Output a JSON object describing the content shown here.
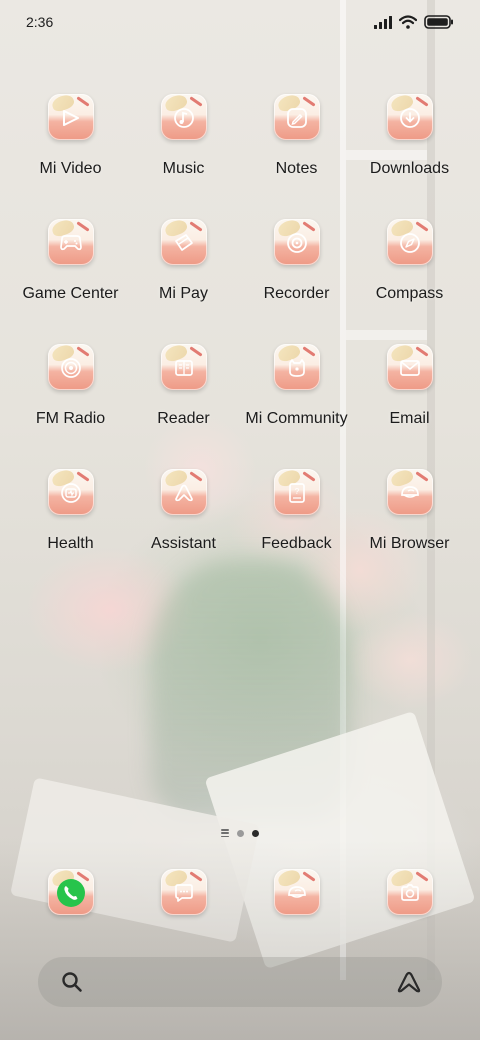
{
  "status_bar": {
    "time": "2:36",
    "icons": [
      "signal-icon",
      "wifi-icon",
      "battery-icon"
    ]
  },
  "apps": [
    {
      "label": "Mi Video",
      "icon": "play-icon"
    },
    {
      "label": "Music",
      "icon": "music-note-icon"
    },
    {
      "label": "Notes",
      "icon": "pencil-icon"
    },
    {
      "label": "Downloads",
      "icon": "download-icon"
    },
    {
      "label": "Game Center",
      "icon": "gamepad-icon"
    },
    {
      "label": "Mi Pay",
      "icon": "card-icon"
    },
    {
      "label": "Recorder",
      "icon": "record-icon"
    },
    {
      "label": "Compass",
      "icon": "compass-icon"
    },
    {
      "label": "FM Radio",
      "icon": "radio-icon"
    },
    {
      "label": "Reader",
      "icon": "book-icon"
    },
    {
      "label": "Mi Community",
      "icon": "community-icon"
    },
    {
      "label": "Email",
      "icon": "envelope-icon"
    },
    {
      "label": "Health",
      "icon": "health-icon"
    },
    {
      "label": "Assistant",
      "icon": "assistant-icon"
    },
    {
      "label": "Feedback",
      "icon": "feedback-icon"
    },
    {
      "label": "Mi Browser",
      "icon": "browser-icon"
    }
  ],
  "page_indicator": {
    "pages": 2,
    "active": 2
  },
  "dock": [
    {
      "app": "Phone",
      "icon": "phone-icon"
    },
    {
      "app": "Messages",
      "icon": "chat-bubble-icon"
    },
    {
      "app": "Browser",
      "icon": "browser-icon"
    },
    {
      "app": "Camera",
      "icon": "camera-icon"
    }
  ],
  "search_bar": {
    "left_icon": "search-icon",
    "right_icon": "assistant-logo-icon"
  },
  "colors": {
    "icon_accent": "#ffffff",
    "icon_bottom": "#ee9a86",
    "phone_green": "#27c44b",
    "label_text": "#1c1c1c"
  }
}
